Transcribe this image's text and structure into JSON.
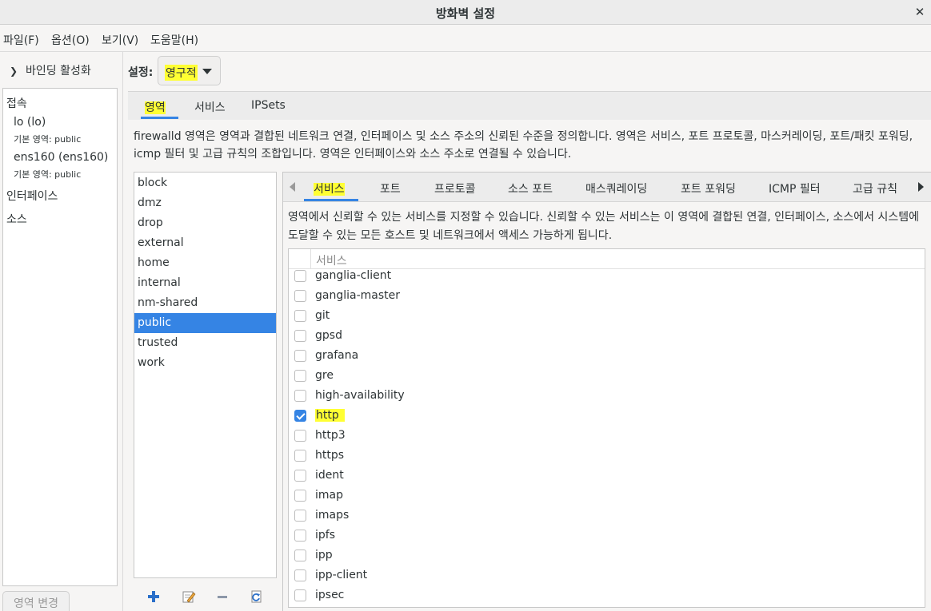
{
  "window": {
    "title": "방화벽 설정"
  },
  "menu": [
    "파일(F)",
    "옵션(O)",
    "보기(V)",
    "도움말(H)"
  ],
  "binding": {
    "label": "바인딩 활성화"
  },
  "connections": {
    "header": "접속",
    "items": [
      {
        "name": "lo (lo)",
        "zone": "기본 영역: public"
      },
      {
        "name": "ens160 (ens160)",
        "zone": "기본 영역: public"
      }
    ],
    "interfaces_label": "인터페이스",
    "sources_label": "소스"
  },
  "zone_change_button": "영역 변경",
  "configuration": {
    "label": "설정:",
    "value": "영구적"
  },
  "main_tabs": [
    "영역",
    "서비스",
    "IPSets"
  ],
  "zone_description": "firewalld 영역은 영역과 결합된 네트워크 연결, 인터페이스 및 소스 주소의 신뢰된 수준을 정의합니다. 영역은 서비스, 포트 프로토콜, 마스커레이딩, 포트/패킷 포워딩, icmp 필터 및 고급 규칙의 조합입니다. 영역은 인터페이스와 소스 주소로 연결될 수 있습니다.",
  "zones": [
    "block",
    "dmz",
    "drop",
    "external",
    "home",
    "internal",
    "nm-shared",
    "public",
    "trusted",
    "work"
  ],
  "selected_zone": "public",
  "zone_tools": [
    "add-icon",
    "edit-icon",
    "remove-icon",
    "reload-icon"
  ],
  "sub_tabs": [
    "서비스",
    "포트",
    "프로토콜",
    "소스 포트",
    "매스쿼레이딩",
    "포트 포워딩",
    "ICMP 필터",
    "고급 규칙"
  ],
  "services_description": "영역에서 신뢰할 수 있는 서비스를 지정할 수 있습니다. 신뢰할 수 있는 서비스는 이 영역에 결합된 연결, 인터페이스, 소스에서 시스템에 도달할 수 있는 모든 호스트 및 네트워크에서 액세스 가능하게 됩니다.",
  "services_table": {
    "column": "서비스",
    "rows": [
      {
        "name": "ganglia-client",
        "checked": false
      },
      {
        "name": "ganglia-master",
        "checked": false
      },
      {
        "name": "git",
        "checked": false
      },
      {
        "name": "gpsd",
        "checked": false
      },
      {
        "name": "grafana",
        "checked": false
      },
      {
        "name": "gre",
        "checked": false
      },
      {
        "name": "high-availability",
        "checked": false
      },
      {
        "name": "http",
        "checked": true
      },
      {
        "name": "http3",
        "checked": false
      },
      {
        "name": "https",
        "checked": false
      },
      {
        "name": "ident",
        "checked": false
      },
      {
        "name": "imap",
        "checked": false
      },
      {
        "name": "imaps",
        "checked": false
      },
      {
        "name": "ipfs",
        "checked": false
      },
      {
        "name": "ipp",
        "checked": false
      },
      {
        "name": "ipp-client",
        "checked": false
      },
      {
        "name": "ipsec",
        "checked": false
      }
    ]
  },
  "colors": {
    "accent": "#3584e4",
    "highlight": "#ffff33"
  }
}
